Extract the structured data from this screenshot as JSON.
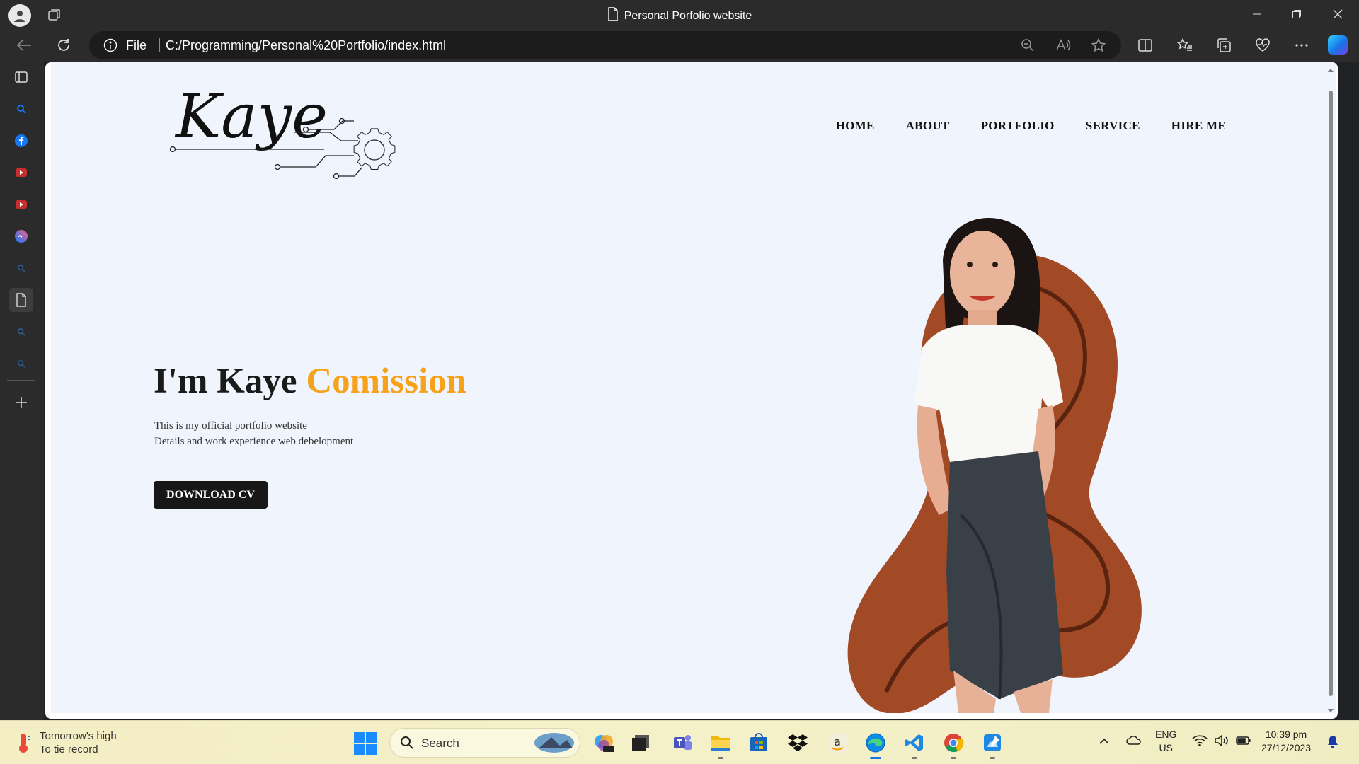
{
  "browser": {
    "tab_title": "Personal Porfolio website",
    "address_scheme": "File",
    "address_url": "C:/Programming/Personal%20Portfolio/index.html"
  },
  "site": {
    "nav": [
      "HOME",
      "ABOUT",
      "PORTFOLIO",
      "SERVICE",
      "HIRE ME"
    ],
    "hero": {
      "greeting": "I'm Kaye ",
      "highlight": "Comission",
      "line1": "This is my official portfolio website",
      "line2": "Details and work experience web debelopment",
      "button": "DOWNLOAD CV"
    },
    "logo_text": "Kaye",
    "colors": {
      "accent": "#f7a21b",
      "background": "#f0f5fd",
      "blob": "#a24a25",
      "button": "#171717"
    }
  },
  "taskbar": {
    "weather_line1": "Tomorrow's high",
    "weather_line2": "To tie record",
    "search_label": "Search",
    "lang_top": "ENG",
    "lang_bottom": "US",
    "time": "10:39 pm",
    "date": "27/12/2023"
  }
}
